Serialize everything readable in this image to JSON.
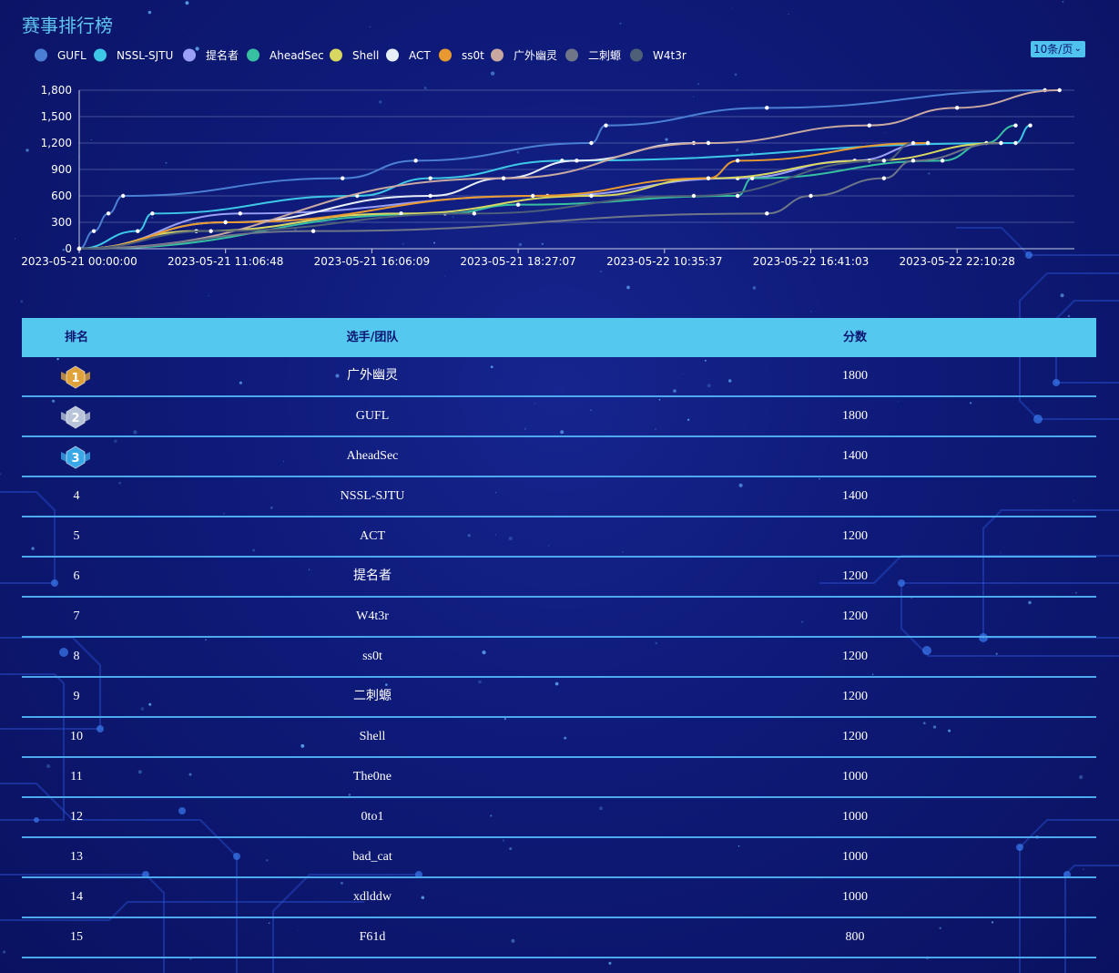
{
  "title": "赛事排行榜",
  "pager": {
    "page_size_label": "10条/页"
  },
  "chart_data": {
    "type": "line",
    "x": [
      "2023-05-21 00:00:00",
      "2023-05-21 11:06:48",
      "2023-05-21 16:06:09",
      "2023-05-21 18:27:07",
      "2023-05-22 10:35:37",
      "2023-05-22 16:41:03",
      "2023-05-22 22:10:28"
    ],
    "ylim": [
      0,
      1800
    ],
    "y_ticks": [
      "0",
      "300",
      "600",
      "900",
      "1,200",
      "1,500",
      "1,800"
    ],
    "grid": true,
    "legend_position": "top-left",
    "series": [
      {
        "name": "GUFL",
        "color": "#4a7fd4",
        "values": [
          [
            0,
            0
          ],
          [
            0.1,
            200
          ],
          [
            0.2,
            400
          ],
          [
            0.3,
            600
          ],
          [
            1.8,
            800
          ],
          [
            2.3,
            1000
          ],
          [
            3.5,
            1200
          ],
          [
            3.6,
            1400
          ],
          [
            4.7,
            1600
          ],
          [
            6.6,
            1800
          ]
        ]
      },
      {
        "name": "NSSL-SJTU",
        "color": "#3ec8e8",
        "values": [
          [
            0,
            0
          ],
          [
            0.4,
            200
          ],
          [
            0.5,
            400
          ],
          [
            1.9,
            600
          ],
          [
            2.4,
            800
          ],
          [
            3.3,
            1000
          ],
          [
            6.4,
            1200
          ],
          [
            6.5,
            1400
          ]
        ]
      },
      {
        "name": "提名者",
        "color": "#9aa0f5",
        "values": [
          [
            0,
            0
          ],
          [
            1.1,
            400
          ],
          [
            3.2,
            600
          ],
          [
            4.5,
            800
          ],
          [
            5.3,
            1000
          ],
          [
            5.8,
            1200
          ]
        ]
      },
      {
        "name": "AheadSec",
        "color": "#36bfa0",
        "values": [
          [
            0,
            0
          ],
          [
            2.5,
            400
          ],
          [
            3.0,
            500
          ],
          [
            4.5,
            600
          ],
          [
            4.6,
            800
          ],
          [
            5.9,
            1000
          ],
          [
            6.2,
            1200
          ],
          [
            6.4,
            1400
          ]
        ]
      },
      {
        "name": "Shell",
        "color": "#d8d860",
        "values": [
          [
            0,
            0
          ],
          [
            0.8,
            200
          ],
          [
            2.2,
            400
          ],
          [
            3.5,
            600
          ],
          [
            4.3,
            800
          ],
          [
            5.4,
            1000
          ],
          [
            6.3,
            1200
          ]
        ]
      },
      {
        "name": "ACT",
        "color": "#e8eef8",
        "values": [
          [
            0,
            0
          ],
          [
            1.0,
            300
          ],
          [
            2.4,
            600
          ],
          [
            2.9,
            800
          ],
          [
            3.4,
            1000
          ],
          [
            4.2,
            1200
          ]
        ]
      },
      {
        "name": "ss0t",
        "color": "#e89a30",
        "values": [
          [
            0,
            0
          ],
          [
            1.0,
            300
          ],
          [
            3.1,
            600
          ],
          [
            4.3,
            800
          ],
          [
            4.5,
            1000
          ],
          [
            5.8,
            1200
          ]
        ]
      },
      {
        "name": "广外幽灵",
        "color": "#c8a8a0",
        "values": [
          [
            0,
            0
          ],
          [
            2.9,
            800
          ],
          [
            4.3,
            1200
          ],
          [
            5.4,
            1400
          ],
          [
            6.0,
            1600
          ],
          [
            6.7,
            1800
          ]
        ]
      },
      {
        "name": "二刺螈",
        "color": "#6e7688",
        "values": [
          [
            0,
            0
          ],
          [
            1.6,
            200
          ],
          [
            4.7,
            400
          ],
          [
            5.0,
            600
          ],
          [
            5.5,
            800
          ],
          [
            5.7,
            1000
          ],
          [
            6.3,
            1200
          ]
        ]
      },
      {
        "name": "W4t3r",
        "color": "#4e5f78",
        "values": [
          [
            0,
            0
          ],
          [
            0.9,
            200
          ],
          [
            2.7,
            400
          ],
          [
            4.2,
            600
          ],
          [
            5.5,
            1000
          ],
          [
            5.7,
            1200
          ]
        ]
      }
    ]
  },
  "table": {
    "headers": {
      "rank": "排名",
      "team": "选手/团队",
      "score": "分数"
    },
    "rows": [
      {
        "rank": "1",
        "team": "广外幽灵",
        "score": "1800"
      },
      {
        "rank": "2",
        "team": "GUFL",
        "score": "1800"
      },
      {
        "rank": "3",
        "team": "AheadSec",
        "score": "1400"
      },
      {
        "rank": "4",
        "team": "NSSL-SJTU",
        "score": "1400"
      },
      {
        "rank": "5",
        "team": "ACT",
        "score": "1200"
      },
      {
        "rank": "6",
        "team": "提名者",
        "score": "1200"
      },
      {
        "rank": "7",
        "team": "W4t3r",
        "score": "1200"
      },
      {
        "rank": "8",
        "team": "ss0t",
        "score": "1200"
      },
      {
        "rank": "9",
        "team": "二刺螈",
        "score": "1200"
      },
      {
        "rank": "10",
        "team": "Shell",
        "score": "1200"
      },
      {
        "rank": "11",
        "team": "The0ne",
        "score": "1000"
      },
      {
        "rank": "12",
        "team": "0to1",
        "score": "1000"
      },
      {
        "rank": "13",
        "team": "bad_cat",
        "score": "1000"
      },
      {
        "rank": "14",
        "team": "xdlddw",
        "score": "1000"
      },
      {
        "rank": "15",
        "team": "F61d",
        "score": "800"
      }
    ]
  },
  "colors": {
    "medal_gold": "#e0a23a",
    "medal_silver": "#b8c4d8",
    "medal_bronze": "#3aa8e8",
    "header_bg": "#55c8ef",
    "accent": "#4da8ee"
  }
}
